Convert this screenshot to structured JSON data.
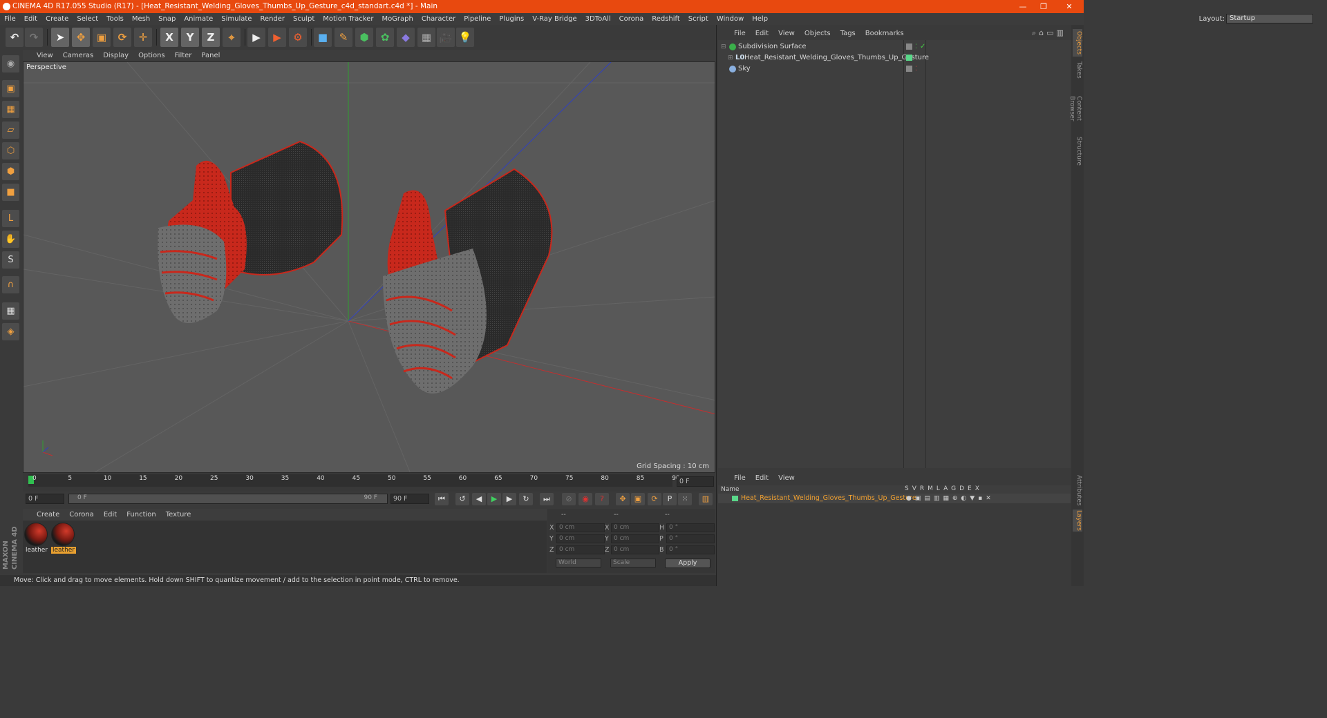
{
  "titlebar": {
    "title": "CINEMA 4D R17.055 Studio (R17) - [Heat_Resistant_Welding_Gloves_Thumbs_Up_Gesture_c4d_standart.c4d *] - Main",
    "minimize": "—",
    "restore": "❐",
    "close": "✕"
  },
  "menubar": {
    "items": [
      "File",
      "Edit",
      "Create",
      "Select",
      "Tools",
      "Mesh",
      "Snap",
      "Animate",
      "Simulate",
      "Render",
      "Sculpt",
      "Motion Tracker",
      "MoGraph",
      "Character",
      "Pipeline",
      "Plugins",
      "V-Ray Bridge",
      "3DToAll",
      "Corona",
      "Redshift",
      "Script",
      "Window",
      "Help"
    ],
    "layout_label": "Layout:",
    "layout_value": "Startup"
  },
  "toolbar": {
    "undo": "↶",
    "redo": "↷",
    "select": "➤",
    "move": "✥",
    "scale": "▣",
    "rotate": "⟳",
    "transform": "✛",
    "x": "X",
    "y": "Y",
    "z": "Z",
    "coord": "⌖",
    "render_view": "▶",
    "render_picture": "▶",
    "render_settings": "⚙",
    "cube": "■",
    "pen": "✎",
    "subdiv": "⬢",
    "cloner": "✿",
    "deformer": "◆",
    "floor": "▦",
    "camera": "🎥",
    "light": "💡"
  },
  "viewport": {
    "menu": [
      "View",
      "Cameras",
      "Display",
      "Options",
      "Filter",
      "Panel"
    ],
    "label": "Perspective",
    "grid_spacing": "Grid Spacing : 10 cm",
    "nav_icons": "✥⬍⟲▢",
    "colors": {
      "background": "#585858",
      "glove_red": "#c8281c",
      "glove_gray": "#6e6e6e",
      "glove_black": "#262626",
      "axis_x": "#c03030",
      "axis_y": "#30a030",
      "axis_z": "#3040c0"
    }
  },
  "timeline": {
    "ticks": [
      "0",
      "5",
      "10",
      "15",
      "20",
      "25",
      "30",
      "35",
      "40",
      "45",
      "50",
      "55",
      "60",
      "65",
      "70",
      "75",
      "80",
      "85",
      "90"
    ],
    "frame_field": "0 F"
  },
  "transport": {
    "start": "0 F",
    "range_start": "0 F",
    "range_end": "90 F",
    "end": "90 F"
  },
  "material_manager": {
    "menu": [
      "Create",
      "Corona",
      "Edit",
      "Function",
      "Texture"
    ],
    "materials": [
      {
        "name": "leather",
        "selected": false
      },
      {
        "name": "leather",
        "selected": true
      }
    ]
  },
  "coordinates": {
    "headers": [
      "--",
      "--",
      "--"
    ],
    "rows": [
      {
        "a": "X",
        "av": "0 cm",
        "b": "X",
        "bv": "0 cm",
        "c": "H",
        "cv": "0 °"
      },
      {
        "a": "Y",
        "av": "0 cm",
        "b": "Y",
        "bv": "0 cm",
        "c": "P",
        "cv": "0 °"
      },
      {
        "a": "Z",
        "av": "0 cm",
        "b": "Z",
        "bv": "0 cm",
        "c": "B",
        "cv": "0 °"
      }
    ],
    "space": "World",
    "mode": "Scale",
    "apply": "Apply"
  },
  "status": "Move: Click and drag to move elements. Hold down SHIFT to quantize movement / add to the selection in point mode, CTRL to remove.",
  "object_manager": {
    "menu": [
      "File",
      "Edit",
      "View",
      "Objects",
      "Tags",
      "Bookmarks"
    ],
    "objects": [
      {
        "name": "Subdivision Surface",
        "icon_color": "#3ab04a"
      },
      {
        "name": "Heat_Resistant_Welding_Gloves_Thumbs_Up_Gesture",
        "icon_color": "#9bbbd8"
      },
      {
        "name": "Sky",
        "icon_color": "#8ab0e0"
      }
    ]
  },
  "layer_manager": {
    "menu": [
      "File",
      "Edit",
      "View"
    ],
    "name_header": "Name",
    "cols": "SVRMLAGDEX",
    "row": "Heat_Resistant_Welding_Gloves_Thumbs_Up_Gesture"
  },
  "sidetabs": [
    "Objects",
    "Takes",
    "Content Browser",
    "Structure",
    "Attributes",
    "Layers"
  ],
  "branding": "MAXON CINEMA 4D"
}
